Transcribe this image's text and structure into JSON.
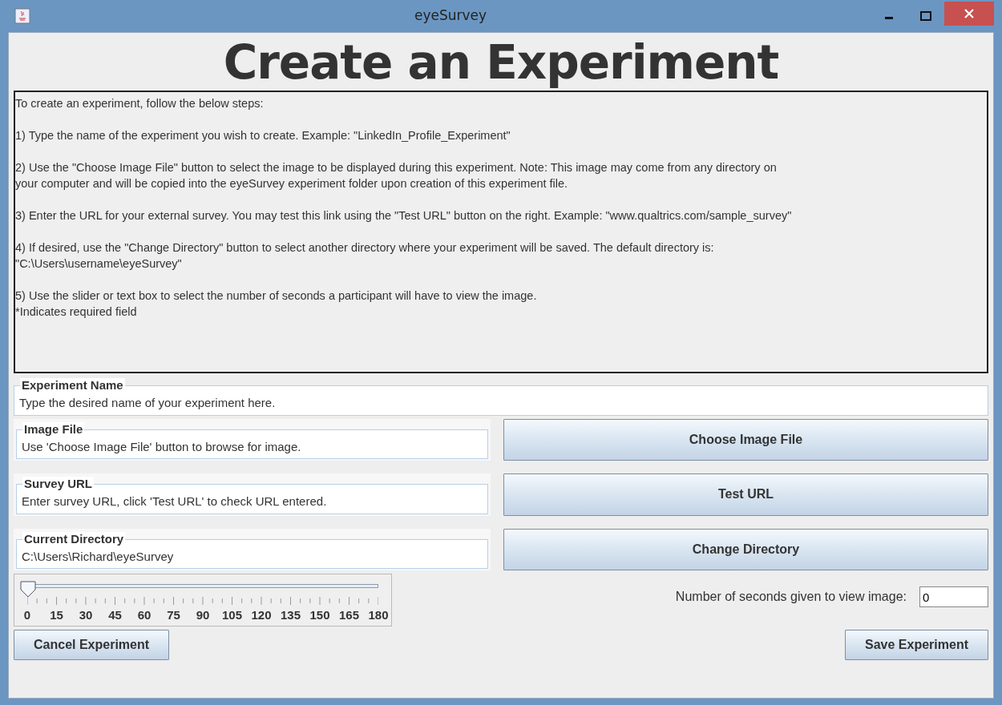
{
  "window": {
    "title": "eyeSurvey"
  },
  "heading": "Create an Experiment",
  "instructions": [
    [
      "To create an experiment, follow the below steps:"
    ],
    [
      "1) Type the name of the experiment you wish to create.  Example: \"LinkedIn_Profile_Experiment\""
    ],
    [
      "2) Use the \"Choose Image File\" button to select the image to be displayed during this experiment.  Note: This image may come from any directory on",
      "your computer and will be copied into the eyeSurvey experiment folder upon creation of this experiment file."
    ],
    [
      "3) Enter the URL for your external survey.  You may test this link using the \"Test URL\" button on the right.  Example: \"www.qualtrics.com/sample_survey\""
    ],
    [
      "4) If desired, use the \"Change Directory\" button to select another directory where your experiment will be saved.  The default directory is:",
      "\"C:\\Users\\username\\eyeSurvey\""
    ],
    [
      "5) Use the slider or text box to select the number of seconds a participant will have to view the image.",
      "*Indicates required field"
    ]
  ],
  "fields": [
    {
      "label": "Experiment Name",
      "value": "Type the desired name of your experiment here."
    },
    {
      "label": "Image File",
      "value": "Use 'Choose Image File' button to browse for image.",
      "button": "Choose Image File"
    },
    {
      "label": "Survey URL",
      "value": "Enter survey URL, click 'Test URL' to check URL entered.",
      "button": "Test URL"
    },
    {
      "label": "Current Directory",
      "value": "C:\\Users\\Richard\\eyeSurvey",
      "button": "Change Directory"
    }
  ],
  "slider": {
    "level": 0,
    "labels": [
      "0",
      "15",
      "30",
      "45",
      "60",
      "75",
      "90",
      "105",
      "120",
      "135",
      "150",
      "165",
      "180"
    ]
  },
  "seconds": {
    "label": "Number of seconds given to view image:",
    "value": "0"
  },
  "buttons": [
    "Cancel Experiment",
    "Save Experiment"
  ]
}
